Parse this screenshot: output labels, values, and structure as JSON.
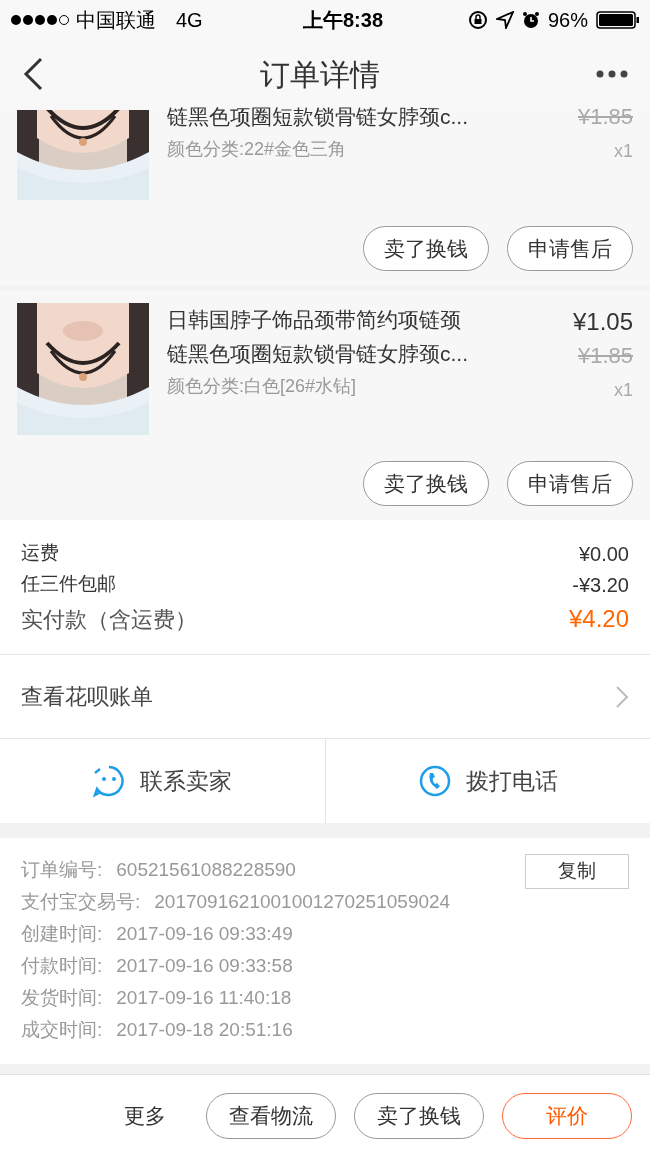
{
  "status_bar": {
    "carrier": "中国联通",
    "network": "4G",
    "time": "上午8:38",
    "battery": "96%"
  },
  "header": {
    "title": "订单详情"
  },
  "items": [
    {
      "title_lines": [
        "链黑色项圈短款锁骨链女脖颈c..."
      ],
      "spec": "颜色分类:22#金色三角",
      "original_price": "¥1.85",
      "quantity": "x1",
      "buttons": [
        "卖了换钱",
        "申请售后"
      ]
    },
    {
      "title_lines": [
        "日韩国脖子饰品颈带简约项链颈",
        "链黑色项圈短款锁骨链女脖颈c..."
      ],
      "spec": "颜色分类:白色[26#水钻]",
      "price": "¥1.05",
      "original_price": "¥1.85",
      "quantity": "x1",
      "buttons": [
        "卖了换钱",
        "申请售后"
      ]
    }
  ],
  "fees": [
    {
      "label": "运费",
      "value": "¥0.00",
      "kind": "normal"
    },
    {
      "label": "任三件包邮",
      "value": "-¥3.20",
      "kind": "normal"
    },
    {
      "label": "实付款（含运费）",
      "value": "¥4.20",
      "kind": "total"
    }
  ],
  "huabei_link": "查看花呗账单",
  "contact": [
    {
      "label": "联系卖家",
      "kind": "chat"
    },
    {
      "label": "拨打电话",
      "kind": "phone"
    }
  ],
  "order_info": {
    "copy_button": "复制",
    "rows": [
      {
        "label": "订单编号:",
        "value": "60521561088228590"
      },
      {
        "label": "支付宝交易号:",
        "value": "2017091621001001270251059024"
      },
      {
        "label": "创建时间:",
        "value": "2017-09-16 09:33:49"
      },
      {
        "label": "付款时间:",
        "value": "2017-09-16 09:33:58"
      },
      {
        "label": "发货时间:",
        "value": "2017-09-16 11:40:18"
      },
      {
        "label": "成交时间:",
        "value": "2017-09-18 20:51:16"
      }
    ]
  },
  "bottom_bar": {
    "more": "更多",
    "buttons": [
      {
        "label": "查看物流",
        "kind": "normal"
      },
      {
        "label": "卖了换钱",
        "kind": "normal"
      },
      {
        "label": "评价",
        "kind": "primary"
      }
    ]
  }
}
